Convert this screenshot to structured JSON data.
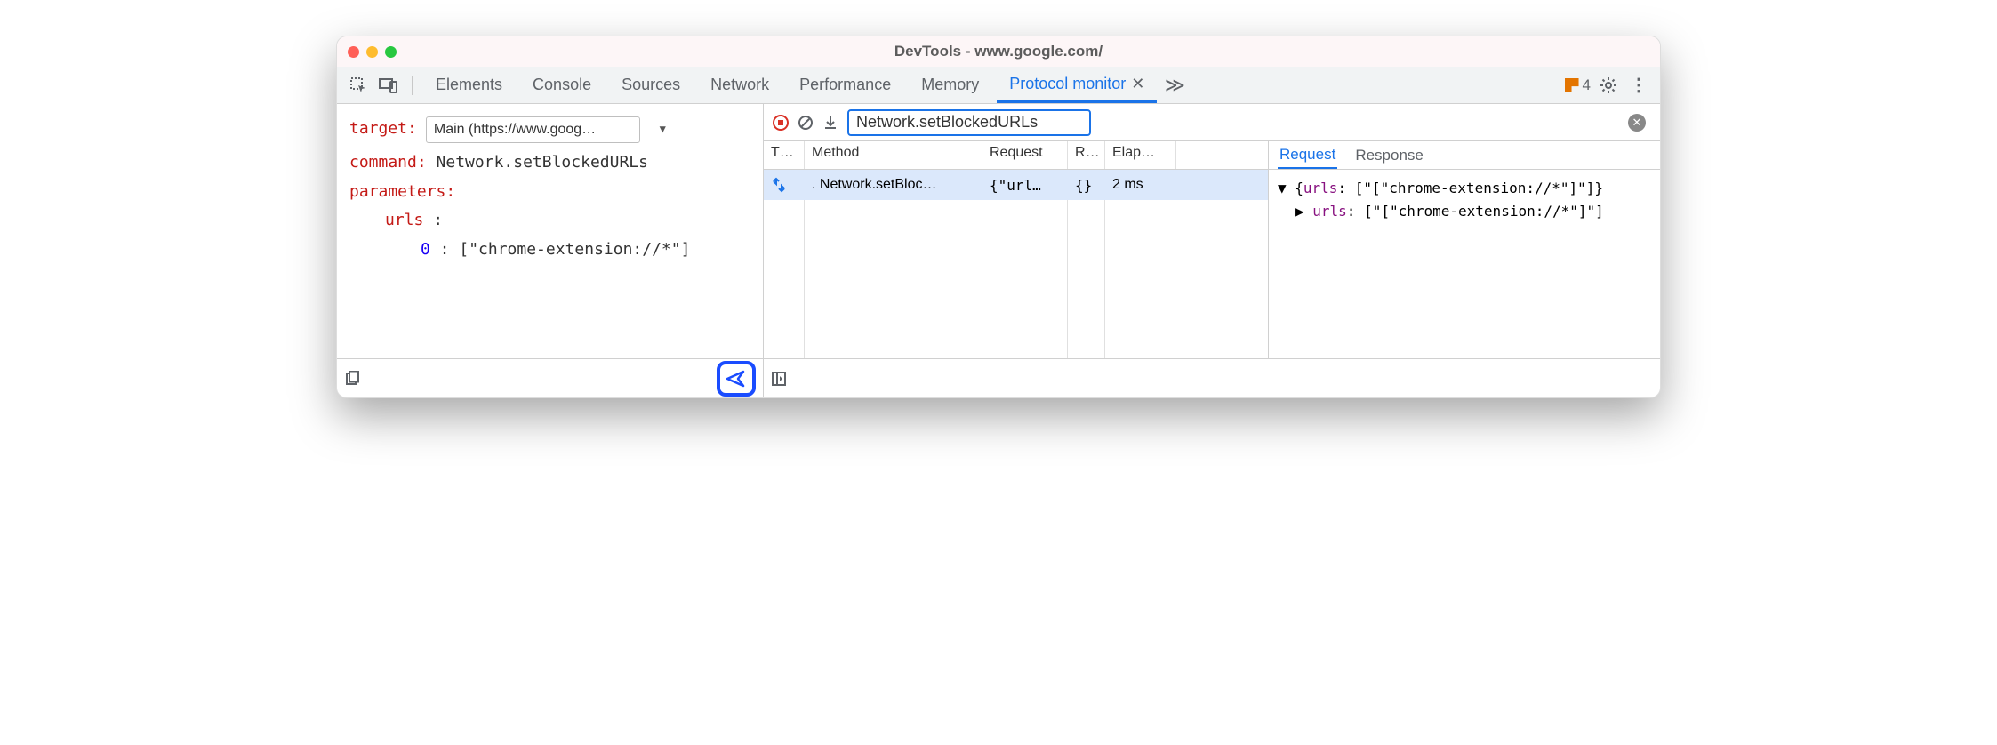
{
  "window": {
    "title": "DevTools - www.google.com/"
  },
  "tabs": {
    "items": [
      "Elements",
      "Console",
      "Sources",
      "Network",
      "Performance",
      "Memory",
      "Protocol monitor"
    ],
    "active": "Protocol monitor",
    "warning_count": "4"
  },
  "editor": {
    "target_label": "target",
    "target_value": "Main (https://www.goog…",
    "command_label": "command",
    "command_value": "Network.setBlockedURLs",
    "parameters_label": "parameters",
    "urls_label": "urls",
    "param_index": "0",
    "param_value": "[\"chrome-extension://*\"]"
  },
  "filter": {
    "value": "Network.setBlockedURLs"
  },
  "grid": {
    "headers": {
      "type": "T…",
      "method": "Method",
      "request": "Request",
      "r": "R…",
      "elapsed": "Elap…"
    },
    "row": {
      "method": "Network.setBloc…",
      "request": "{\"url…",
      "response": "{}",
      "elapsed": "2 ms"
    }
  },
  "details": {
    "tab_request": "Request",
    "tab_response": "Response",
    "line1_key": "urls",
    "line1_val": "[\"[\"chrome-extension://*\"]\"]",
    "line2_key": "urls",
    "line2_val": "[\"[\"chrome-extension://*\"]\"]"
  }
}
